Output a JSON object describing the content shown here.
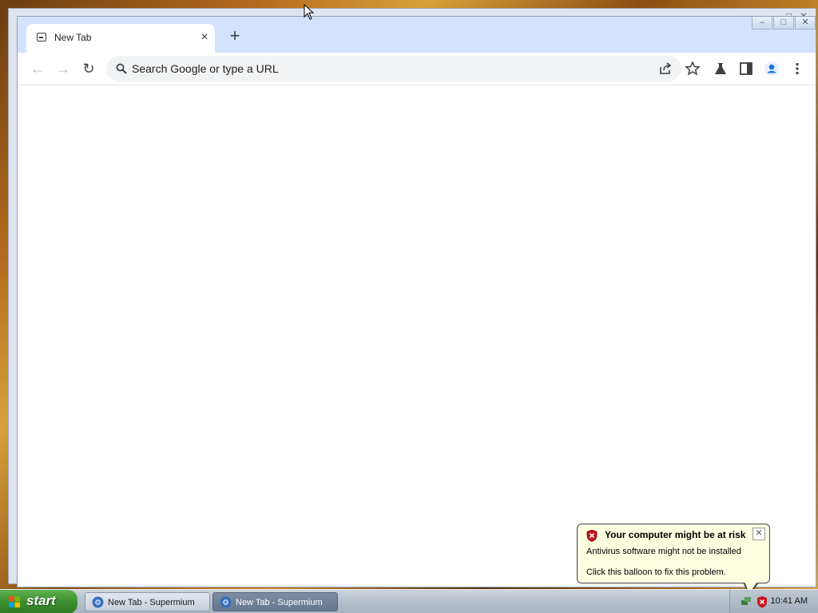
{
  "browser": {
    "tab": {
      "title": "New Tab",
      "close_glyph": "×"
    },
    "new_tab_glyph": "+",
    "window_controls": {
      "minimize": "–",
      "maximize": "□",
      "close": "✕"
    },
    "toolbar": {
      "back_glyph": "←",
      "forward_glyph": "→",
      "reload_glyph": "↻",
      "omnibox_placeholder": "Search Google or type a URL"
    },
    "icons": [
      "search-icon",
      "share-icon",
      "bookmark-star-icon",
      "labs-flask-icon",
      "side-panel-icon",
      "profile-icon",
      "menu-kebab-icon"
    ]
  },
  "taskbar": {
    "start_label": "start",
    "items": [
      {
        "label": "New Tab - Supermium",
        "active": false
      },
      {
        "label": "New Tab - Supermium",
        "active": true
      }
    ],
    "clock": "10:41 AM"
  },
  "balloon": {
    "title": "Your computer might be at risk",
    "line1": "Antivirus software might not be installed",
    "line2": "Click this balloon to fix this problem.",
    "close_glyph": "✕"
  },
  "colors": {
    "tabstrip": "#d3e3fd",
    "omnibox": "#f1f3f4",
    "balloon": "#ffffe1",
    "profile_accent": "#1a73e8"
  }
}
